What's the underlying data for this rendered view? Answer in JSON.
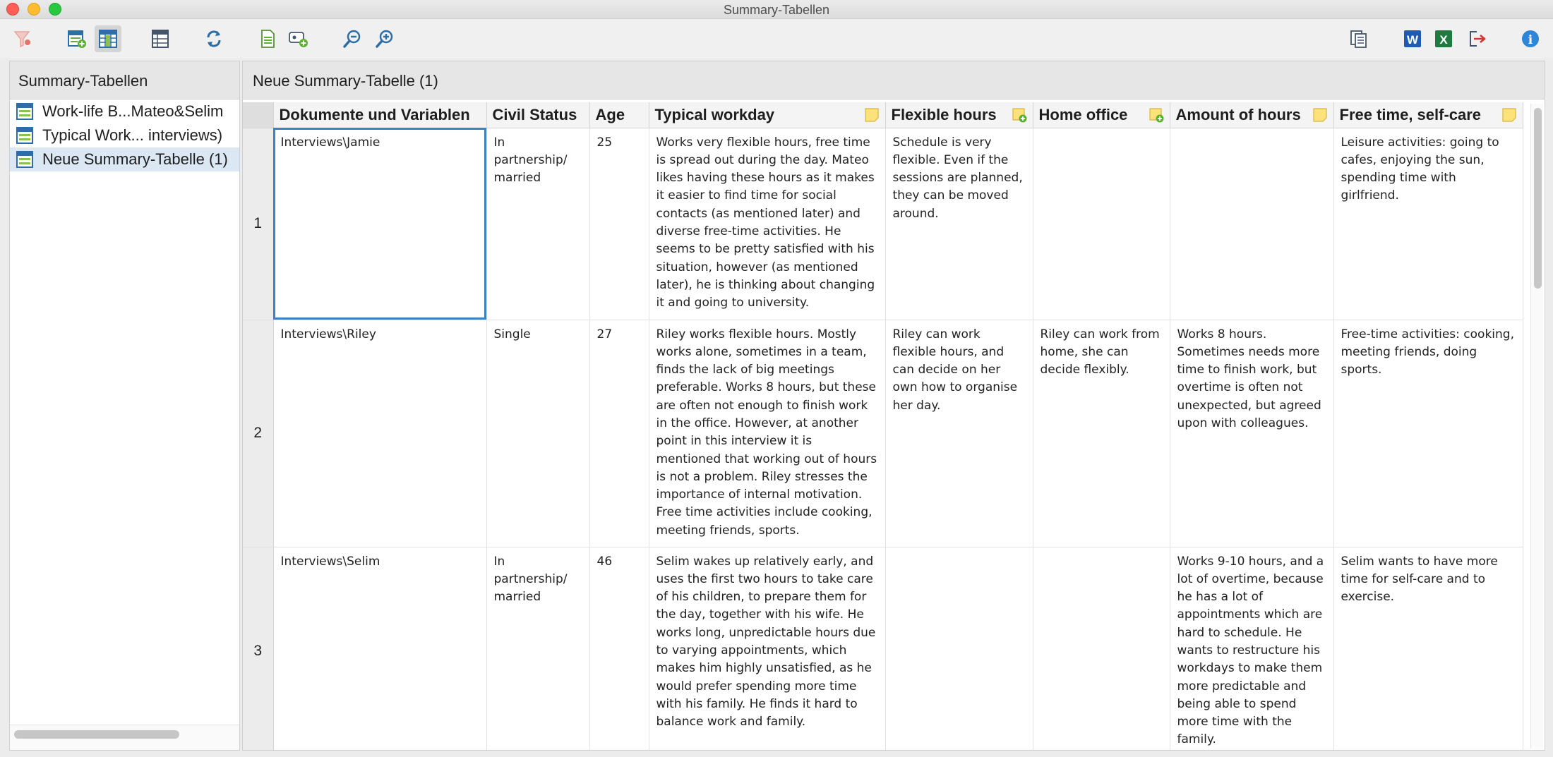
{
  "window": {
    "title": "Summary-Tabellen"
  },
  "toolbar": {
    "left_icons": [
      "filter-icon",
      "new-summary-table-icon",
      "summary-grid-icon",
      "columns-icon",
      "refresh-icon",
      "document-icon",
      "add-variable-icon",
      "zoom-out-icon",
      "zoom-in-icon"
    ],
    "right_icons": [
      "copy-icon",
      "word-export-icon",
      "excel-export-icon",
      "export-icon",
      "info-icon"
    ],
    "word_label": "W",
    "excel_label": "X",
    "info_label": "i"
  },
  "sidebar": {
    "title": "Summary-Tabellen",
    "items": [
      {
        "label": "Work-life B...Mateo&Selim",
        "selected": false
      },
      {
        "label": "Typical Work... interviews)",
        "selected": false
      },
      {
        "label": "Neue Summary-Tabelle (1)",
        "selected": true
      }
    ]
  },
  "main": {
    "title": "Neue Summary-Tabelle (1)",
    "columns": [
      {
        "label": "Dokumente und Variablen",
        "memo": ""
      },
      {
        "label": "Civil Status",
        "memo": ""
      },
      {
        "label": "Age",
        "memo": ""
      },
      {
        "label": "Typical workday",
        "memo": "memo"
      },
      {
        "label": "Flexible hours",
        "memo": "memo-add"
      },
      {
        "label": "Home office",
        "memo": "memo-add"
      },
      {
        "label": "Amount of hours",
        "memo": "memo"
      },
      {
        "label": "Free time, self-care",
        "memo": "memo"
      }
    ],
    "rows": [
      {
        "num": "1",
        "cells": [
          "Interviews\\Jamie",
          "In partnership/ married",
          "25",
          "Works very flexible hours, free time is spread out during the day. Mateo likes having these hours as it makes it easier to find time for social contacts (as mentioned later) and diverse free-time activities. He seems to be pretty satisfied with his situation, however (as mentioned later), he is thinking about changing it and going to university.",
          "Schedule is very flexible. Even if the sessions are planned, they can be moved around.",
          "",
          "",
          "Leisure activities: going to cafes, enjoying the sun, spending time with girlfriend."
        ]
      },
      {
        "num": "2",
        "cells": [
          "Interviews\\Riley",
          "Single",
          "27",
          "Riley works flexible hours. Mostly works alone, sometimes in a team, finds the lack of big meetings preferable. Works 8 hours, but these are often not enough to finish work in the office. However, at another point in this interview it is mentioned that working out of hours is not a problem. Riley stresses the importance of internal motivation. Free time activities include cooking, meeting friends, sports.",
          "Riley can work flexible hours, and can decide on her own how to organise her day.",
          "Riley can work from home, she can decide flexibly.",
          "Works 8 hours. Sometimes needs more time to finish work, but overtime is often not unexpected, but agreed upon with colleagues.",
          "Free-time activities: cooking, meeting friends, doing sports."
        ]
      },
      {
        "num": "3",
        "cells": [
          "Interviews\\Selim",
          "In partnership/ married",
          "46",
          "Selim wakes up relatively early, and uses the first two hours to take care of his children, to prepare them for the day, together with his wife. He works long, unpredictable hours due to varying appointments, which makes him highly unsatisfied, as he would prefer spending more time with his family. He finds it hard to balance work and family.",
          "",
          "",
          "Works 9-10 hours, and a lot of overtime, because he has a lot of appointments which are hard to schedule. He wants to restructure his workdays to make them more predictable and being able to spend more time with the family.",
          "Selim wants to have more time for self-care and to exercise."
        ]
      }
    ]
  }
}
